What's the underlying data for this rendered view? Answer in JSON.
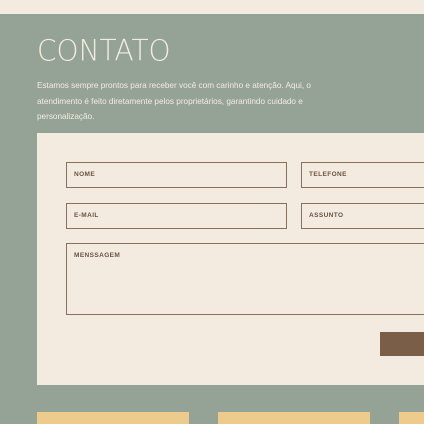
{
  "contact": {
    "title": "CONTATO",
    "intro": "Estamos sempre prontos para receber você com carinho e atenção. Aqui, o atendimento é feito diretamente pelos proprietários, garantindo cuidado e personalização."
  },
  "form": {
    "name_label": "NOME",
    "phone_label": "TELEFONE",
    "email_label": "E-MAIL",
    "subject_label": "ASSUNTO",
    "message_label": "MENSSAGEM",
    "submit_label": ""
  },
  "colors": {
    "background": "#95a396",
    "panel": "#f4ebe0",
    "field_border": "#8a6f5a",
    "button": "#7a5e48",
    "accent_cards": "#eccb8c"
  }
}
